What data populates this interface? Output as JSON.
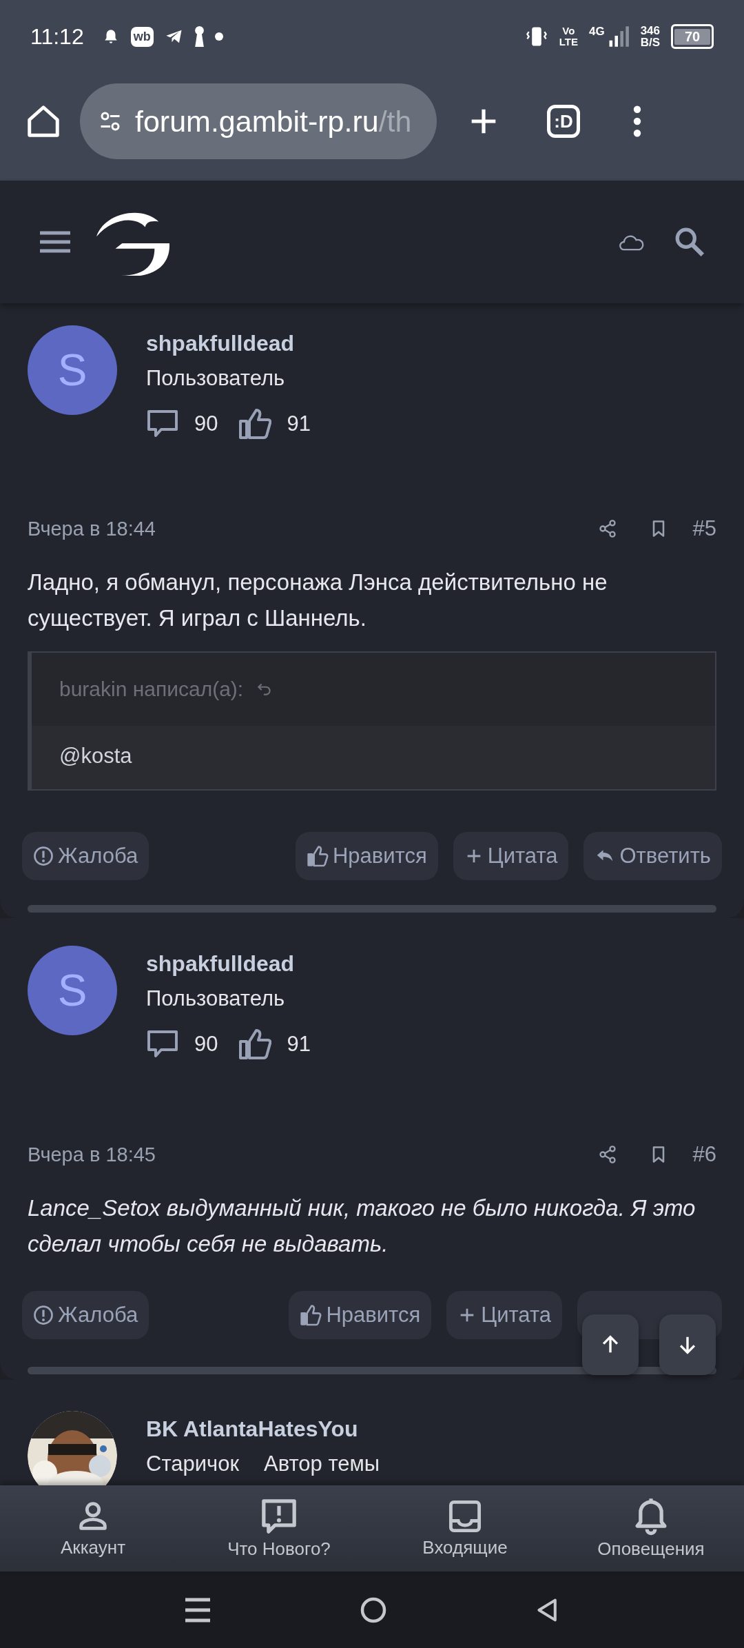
{
  "status_bar": {
    "time": "11:12",
    "app_badge": "wb",
    "volte_top": "Vo",
    "volte_bottom": "LTE",
    "network": "4G",
    "speed_value": "346",
    "speed_unit": "B/S",
    "battery": "70"
  },
  "browser": {
    "url_host": "forum.gambit-rp.ru",
    "url_path": "/th",
    "tabs_label": ":D"
  },
  "posts": [
    {
      "avatar_letter": "S",
      "author": "shpakfulldead",
      "roles": [
        "Пользователь"
      ],
      "messages": "90",
      "likes": "91",
      "date": "Вчера в 18:44",
      "number": "#5",
      "italic": false,
      "text": "Ладно, я обманул, персонажа Лэнса действительно не существует. Я играл с Шаннель.",
      "quote": {
        "header": "burakin написал(а):",
        "content": "@kosta"
      },
      "actions": [
        {
          "kind": "report",
          "label": "Жалоба"
        },
        {
          "kind": "like",
          "label": "Нравится"
        },
        {
          "kind": "quote",
          "label": "Цитата"
        },
        {
          "kind": "reply",
          "label": "Ответить"
        }
      ]
    },
    {
      "avatar_letter": "S",
      "author": "shpakfulldead",
      "roles": [
        "Пользователь"
      ],
      "messages": "90",
      "likes": "91",
      "date": "Вчера в 18:45",
      "number": "#6",
      "italic": true,
      "text": "Lance_Setox выдуманный ник, такого не было никогда. Я это сделал чтобы себя не выдавать.",
      "actions": [
        {
          "kind": "report",
          "label": "Жалоба"
        },
        {
          "kind": "like",
          "label": "Нравится"
        },
        {
          "kind": "quote",
          "label": "Цитата"
        },
        {
          "kind": "covered"
        }
      ]
    },
    {
      "author": "BK AtlantaHatesYou",
      "roles": [
        "Старичок",
        "Автор темы"
      ]
    }
  ],
  "bottom_nav": [
    {
      "kind": "account",
      "label": "Аккаунт"
    },
    {
      "kind": "whats_new",
      "label": "Что Нового?"
    },
    {
      "kind": "inbox",
      "label": "Входящие"
    },
    {
      "kind": "alerts",
      "label": "Оповещения"
    }
  ]
}
